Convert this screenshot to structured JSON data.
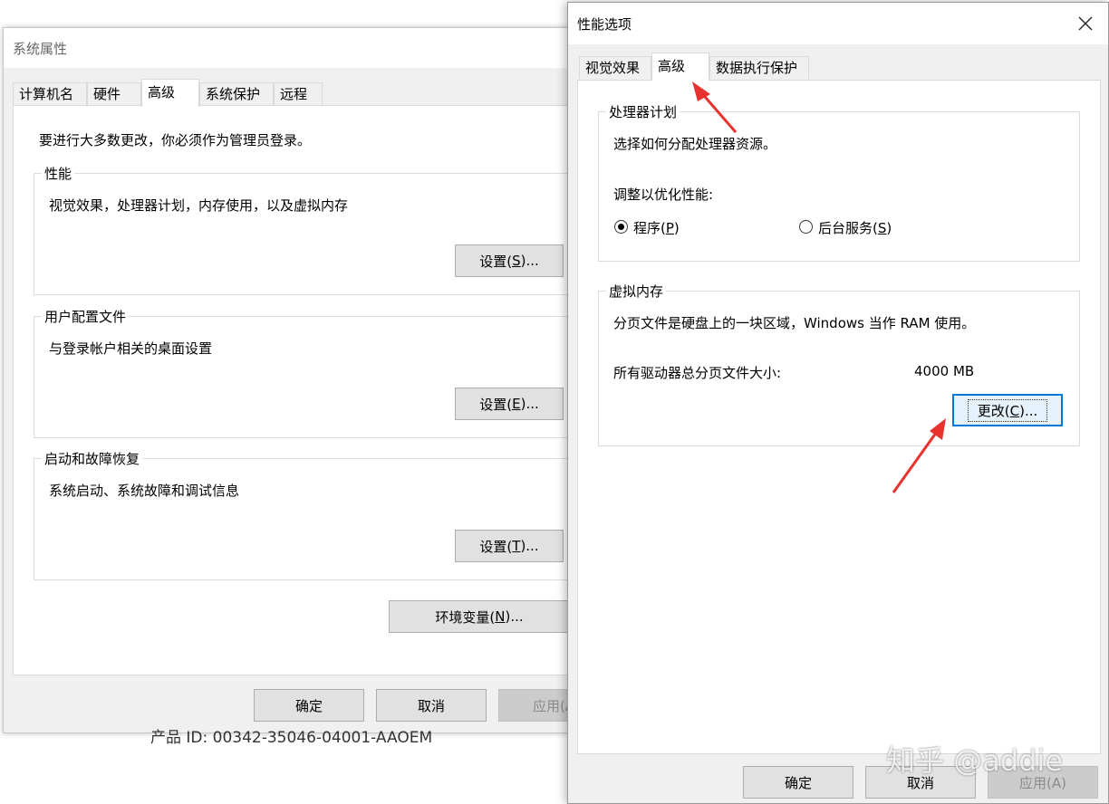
{
  "sys_props": {
    "title": "系统属性",
    "tabs": [
      "计算机名",
      "硬件",
      "高级",
      "系统保护",
      "远程"
    ],
    "admin_notice": "要进行大多数更改，你必须作为管理员登录。",
    "performance": {
      "label": "性能",
      "desc": "视觉效果，处理器计划，内存使用，以及虚拟内存",
      "btn_pre": "设置(",
      "btn_key": "S",
      "btn_post": ")..."
    },
    "profile": {
      "label": "用户配置文件",
      "desc": "与登录帐户相关的桌面设置",
      "btn_pre": "设置(",
      "btn_key": "E",
      "btn_post": ")..."
    },
    "startup": {
      "label": "启动和故障恢复",
      "desc": "系统启动、系统故障和调试信息",
      "btn_pre": "设置(",
      "btn_key": "T",
      "btn_post": ")..."
    },
    "env_pre": "环境变量(",
    "env_key": "N",
    "env_post": ")...",
    "ok": "确定",
    "cancel": "取消",
    "apply": "应用(A",
    "product_id": "产品 ID: 00342-35046-04001-AAOEM"
  },
  "perf_opts": {
    "title": "性能选项",
    "tabs": [
      "视觉效果",
      "高级",
      "数据执行保护"
    ],
    "processor": {
      "label": "处理器计划",
      "desc": "选择如何分配处理器资源。",
      "adjust": "调整以优化性能:",
      "programs_pre": "程序(",
      "programs_key": "P",
      "programs_post": ")",
      "background_pre": "后台服务(",
      "background_key": "S",
      "background_post": ")"
    },
    "vmem": {
      "label": "虚拟内存",
      "desc": "分页文件是硬盘上的一块区域，Windows 当作 RAM 使用。",
      "total_label": "所有驱动器总分页文件大小:",
      "total_value": "4000 MB",
      "change_pre": "更改(",
      "change_key": "C",
      "change_post": ")..."
    },
    "ok": "确定",
    "cancel": "取消",
    "apply": "应用(A)"
  },
  "watermark": "知乎 @addie",
  "colors": {
    "arrow": "#e8322e",
    "focus": "#0078d7"
  }
}
